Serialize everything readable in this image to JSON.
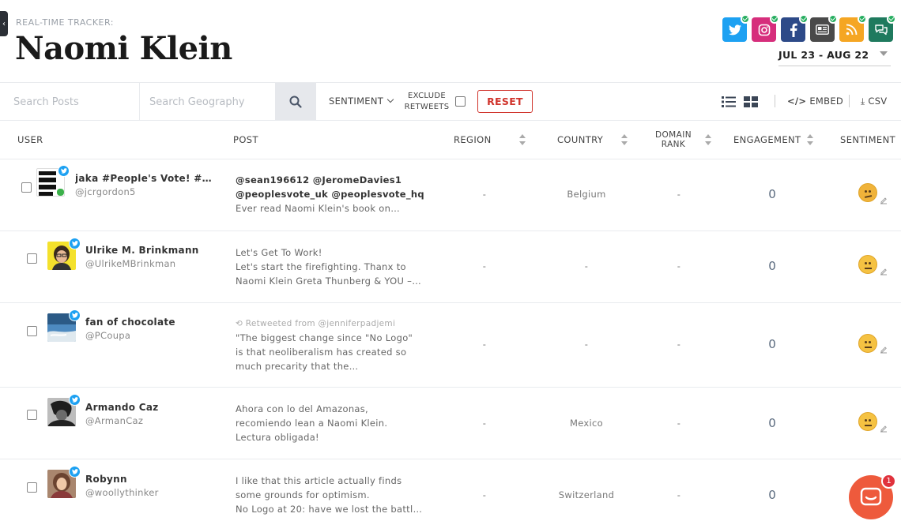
{
  "header": {
    "tracker_label": "REAL-TIME TRACKER:",
    "title": "Naomi Klein",
    "date_range": "JUL 23 - AUG 22"
  },
  "social": [
    {
      "name": "twitter-icon",
      "color": "#1da1f2"
    },
    {
      "name": "instagram-icon",
      "color": "#d62e7c"
    },
    {
      "name": "facebook-icon",
      "color": "#2d4a88"
    },
    {
      "name": "news-icon",
      "color": "#4a4a4a"
    },
    {
      "name": "rss-icon",
      "color": "#f5a623"
    },
    {
      "name": "forum-icon",
      "color": "#1f7a5e"
    }
  ],
  "toolbar": {
    "search_posts_placeholder": "Search Posts",
    "search_geo_placeholder": "Search Geography",
    "sentiment_label": "SENTIMENT",
    "exclude_label": "EXCLUDE RETWEETS",
    "reset_label": "RESET",
    "embed_label": "EMBED",
    "csv_label": "CSV"
  },
  "columns": {
    "user": "USER",
    "post": "POST",
    "region": "REGION",
    "country": "COUNTRY",
    "domain_rank": "DOMAIN RANK",
    "engagement": "ENGAGEMENT",
    "sentiment": "SENTIMENT"
  },
  "rows": [
    {
      "name": "jaka #People's Vote! #Rev…",
      "handle": "@jcrgordon5",
      "post_bold_1": "@sean196612 @JeromeDavies1",
      "post_bold_2": "@peoplesvote_uk @peoplesvote_hq",
      "post_line": "Ever read Naomi Klein's book on…",
      "region": "-",
      "country": "Belgium",
      "domain_rank": "-",
      "engagement": "0"
    },
    {
      "name": "Ulrike M. Brinkmann",
      "handle": "@UlrikeMBrinkman",
      "post_line_1": "Let's Get To Work!",
      "post_line_2": "Let's start the firefighting. Thanx to",
      "post_line_3": "Naomi Klein Greta Thunberg & YOU –…",
      "region": "-",
      "country": "-",
      "domain_rank": "-",
      "engagement": "0"
    },
    {
      "name": "fan of chocolate",
      "handle": "@PCoupa",
      "retweet_label": "Retweeted from @jenniferpadjemi",
      "post_line_1": "\"The biggest change since \"No Logo\"",
      "post_line_2": "is that neoliberalism has created so",
      "post_line_3": "much precarity that the…",
      "region": "-",
      "country": "-",
      "domain_rank": "-",
      "engagement": "0"
    },
    {
      "name": "Armando Caz",
      "handle": "@ArmanCaz",
      "post_line_1": "Ahora con lo del Amazonas,",
      "post_line_2": "recomiendo lean a Naomi Klein.",
      "post_line_3": "Lectura obligada!",
      "region": "-",
      "country": "Mexico",
      "domain_rank": "-",
      "engagement": "0"
    },
    {
      "name": "Robynn",
      "handle": "@woollythinker",
      "post_line_1": "I like that this article actually finds",
      "post_line_2": "some grounds for optimism.",
      "post_line_3": "No Logo at 20: have we lost the battl…",
      "region": "-",
      "country": "Switzerland",
      "domain_rank": "-",
      "engagement": "0"
    }
  ],
  "chat": {
    "badge_count": "1"
  }
}
